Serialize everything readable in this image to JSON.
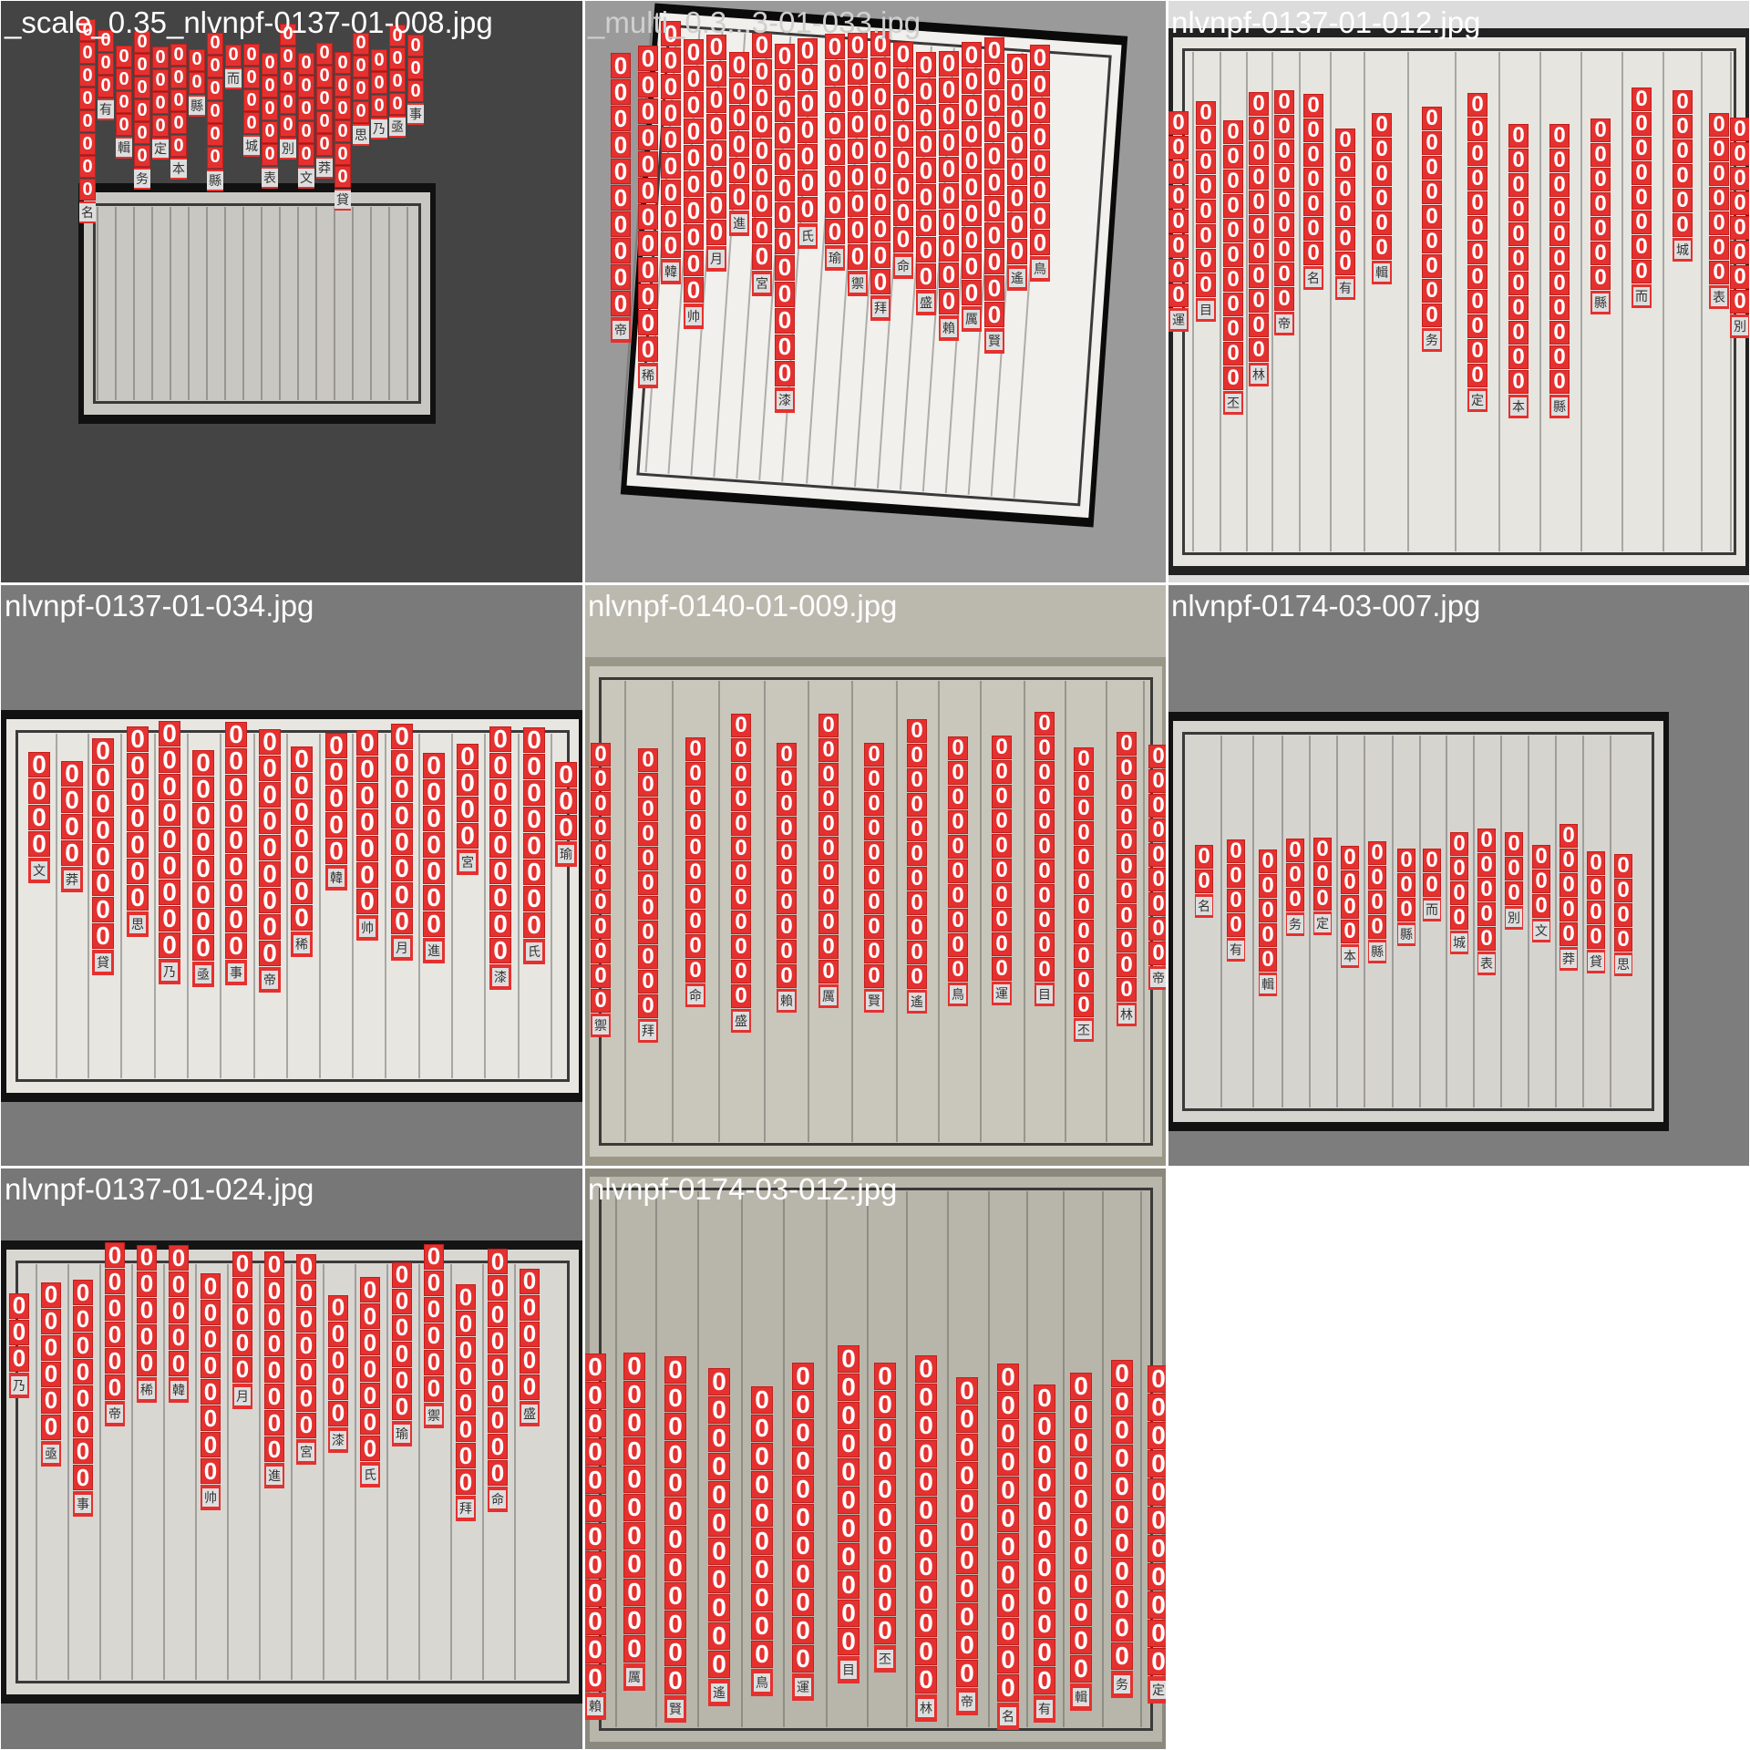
{
  "colors": {
    "box": "#e4312f",
    "label_text": "#ffffff"
  },
  "box_label": "0",
  "tiles": [
    {
      "title": "_scale_0.35_nlvnpf-0137-01-008.jpg",
      "title_color": "#ffffff"
    },
    {
      "title": "_multi_0.3...3-01-033.jpg",
      "title_color": "#cfcfcf"
    },
    {
      "title": "nlvnpf-0137-01-012.jpg",
      "title_color": "#ffffff"
    },
    {
      "title": "nlvnpf-0137-01-034.jpg",
      "title_color": "#ffffff"
    },
    {
      "title": "nlvnpf-0140-01-009.jpg",
      "title_color": "#ffffff"
    },
    {
      "title": "nlvnpf-0174-03-007.jpg",
      "title_color": "#ffffff"
    },
    {
      "title": "nlvnpf-0137-01-024.jpg",
      "title_color": "#ffffff"
    },
    {
      "title": "nlvnpf-0174-03-012.jpg",
      "title_color": "#ffffff"
    }
  ],
  "glyphs": [
    "名",
    "有",
    "輯",
    "务",
    "定",
    "本",
    "縣",
    "縣",
    "而",
    "城",
    "表",
    "別",
    "文",
    "莽",
    "貸",
    "思",
    "乃",
    "亟",
    "事",
    "帝",
    "稀",
    "韓",
    "帅",
    "月",
    "進",
    "宮",
    "漆",
    "氏",
    "瑜",
    "禦",
    "拜",
    "命",
    "盛",
    "賴",
    "厲",
    "賢",
    "遙",
    "鳥",
    "運",
    "目",
    "丕",
    "林",
    "帝"
  ]
}
